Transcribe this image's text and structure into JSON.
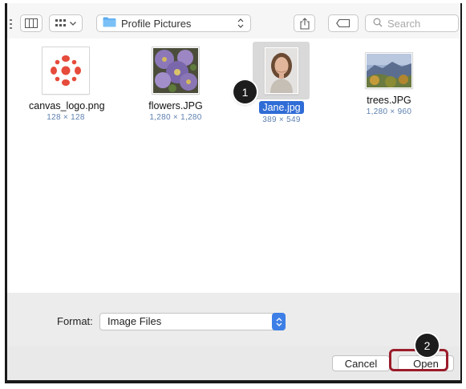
{
  "toolbar": {
    "path_label": "Profile Pictures",
    "search_placeholder": "Search"
  },
  "files": [
    {
      "name": "canvas_logo.png",
      "dims": "128 × 128"
    },
    {
      "name": "flowers.JPG",
      "dims": "1,280 × 1,280"
    },
    {
      "name": "Jane.jpg",
      "dims": "389 × 549",
      "selected": true
    },
    {
      "name": "trees.JPG",
      "dims": "1,280 × 960"
    }
  ],
  "callouts": {
    "one": "1",
    "two": "2"
  },
  "format": {
    "label": "Format:",
    "value": "Image Files"
  },
  "buttons": {
    "cancel": "Cancel",
    "open": "Open"
  },
  "colors": {
    "selection": "#2f6cd6",
    "highlight_ring": "#9b1c2b",
    "folder": "#5aaaf0",
    "logo": "#e64b3b"
  }
}
